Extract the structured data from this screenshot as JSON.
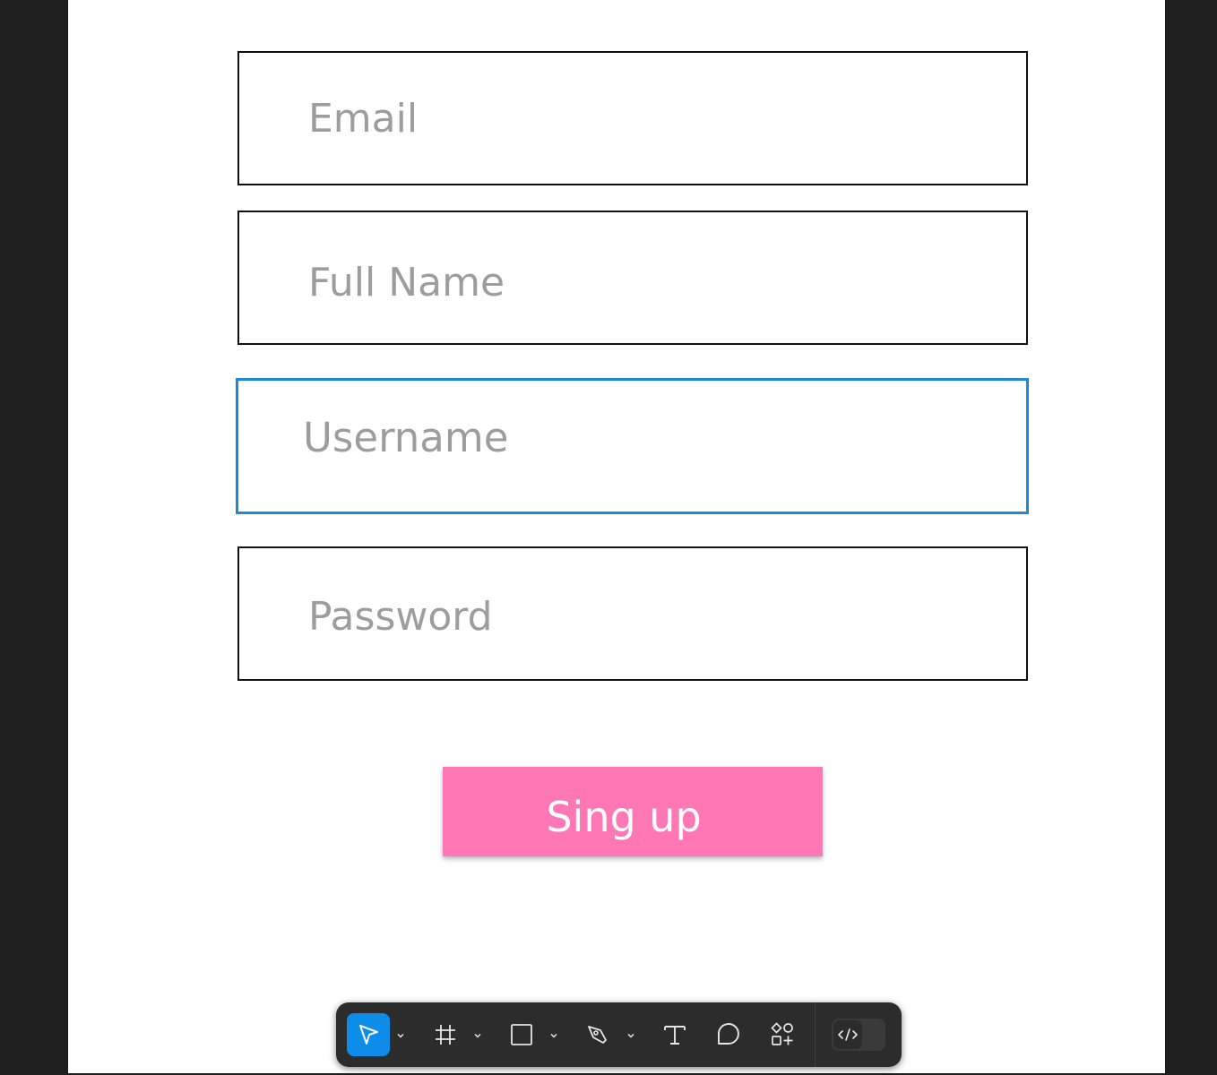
{
  "form": {
    "fields": [
      {
        "name": "email",
        "placeholder": "Email"
      },
      {
        "name": "full-name",
        "placeholder": "Full Name"
      },
      {
        "name": "username",
        "placeholder": "Username"
      },
      {
        "name": "password",
        "placeholder": "Password"
      }
    ],
    "submit_label": "Sing up",
    "focused_field": "username"
  },
  "toolbar": {
    "tools": [
      "move-tool",
      "frame-tool",
      "rectangle-tool",
      "pen-tool",
      "text-tool",
      "comment-tool",
      "actions-tool"
    ],
    "active_tool": "move-tool",
    "dev_mode_toggle": "code-icon"
  },
  "colors": {
    "focus_border": "#1e88d9",
    "button_bg": "#ff77b4",
    "toolbar_bg": "#2c2c2c",
    "active_tool_bg": "#0d8ce9",
    "placeholder_text": "#9d9d9d"
  }
}
